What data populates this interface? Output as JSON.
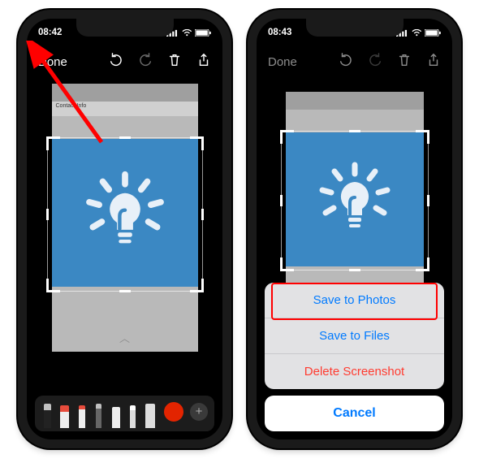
{
  "phones": {
    "left": {
      "status": {
        "time": "08:42",
        "signal_icon": "cellular-bars",
        "wifi_icon": "wifi",
        "battery_icon": "battery"
      },
      "nav": {
        "done_label": "Done",
        "icons": {
          "undo": "undo-icon",
          "redo": "redo-icon",
          "trash": "trash-icon",
          "share": "share-icon"
        },
        "redo_enabled": false
      },
      "screenshot": {
        "header_text": "Contact Info"
      },
      "toolbar": {
        "tools": [
          "pen",
          "marker",
          "marker-thin",
          "pencil",
          "eraser",
          "lasso",
          "ruler"
        ],
        "color_hex": "#e32400",
        "add_label": "+"
      }
    },
    "right": {
      "status": {
        "time": "08:43",
        "signal_icon": "cellular-bars",
        "wifi_icon": "wifi",
        "battery_icon": "battery"
      },
      "nav": {
        "done_label": "Done",
        "icons": {
          "undo": "undo-icon",
          "redo": "redo-icon",
          "trash": "trash-icon",
          "share": "share-icon"
        },
        "redo_enabled": false
      },
      "action_sheet": {
        "options": [
          {
            "label": "Save to Photos",
            "destructive": false,
            "highlighted": true
          },
          {
            "label": "Save to Files",
            "destructive": false,
            "highlighted": false
          },
          {
            "label": "Delete Screenshot",
            "destructive": true,
            "highlighted": false
          }
        ],
        "cancel_label": "Cancel"
      }
    }
  },
  "annotation": {
    "arrow_target": "done-button",
    "arrow_color": "#ff0000"
  }
}
